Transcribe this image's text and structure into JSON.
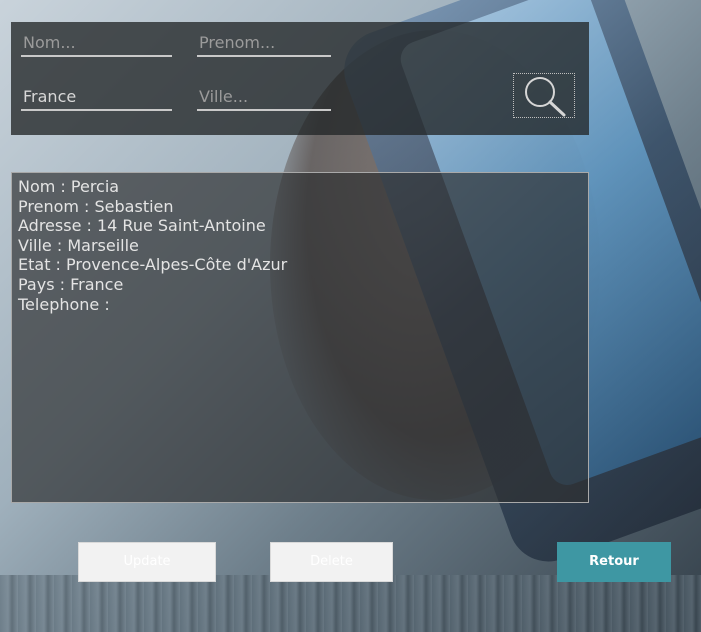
{
  "search": {
    "nom_placeholder": "Nom...",
    "prenom_placeholder": "Prenom...",
    "pays_value": "France",
    "ville_placeholder": "Ville..."
  },
  "icons": {
    "search": "search-icon"
  },
  "result": {
    "lines": [
      "Nom : Percia",
      "Prenom : Sebastien",
      "Adresse : 14 Rue Saint-Antoine",
      "Ville : Marseille",
      "Etat : Provence-Alpes-Côte d'Azur",
      "Pays : France",
      "Telephone :"
    ]
  },
  "buttons": {
    "update_label": "Update",
    "delete_label": "Delete",
    "retour_label": "Retour"
  },
  "colors": {
    "accent": "#3e97a3",
    "panel_bg": "#2d2f31"
  }
}
